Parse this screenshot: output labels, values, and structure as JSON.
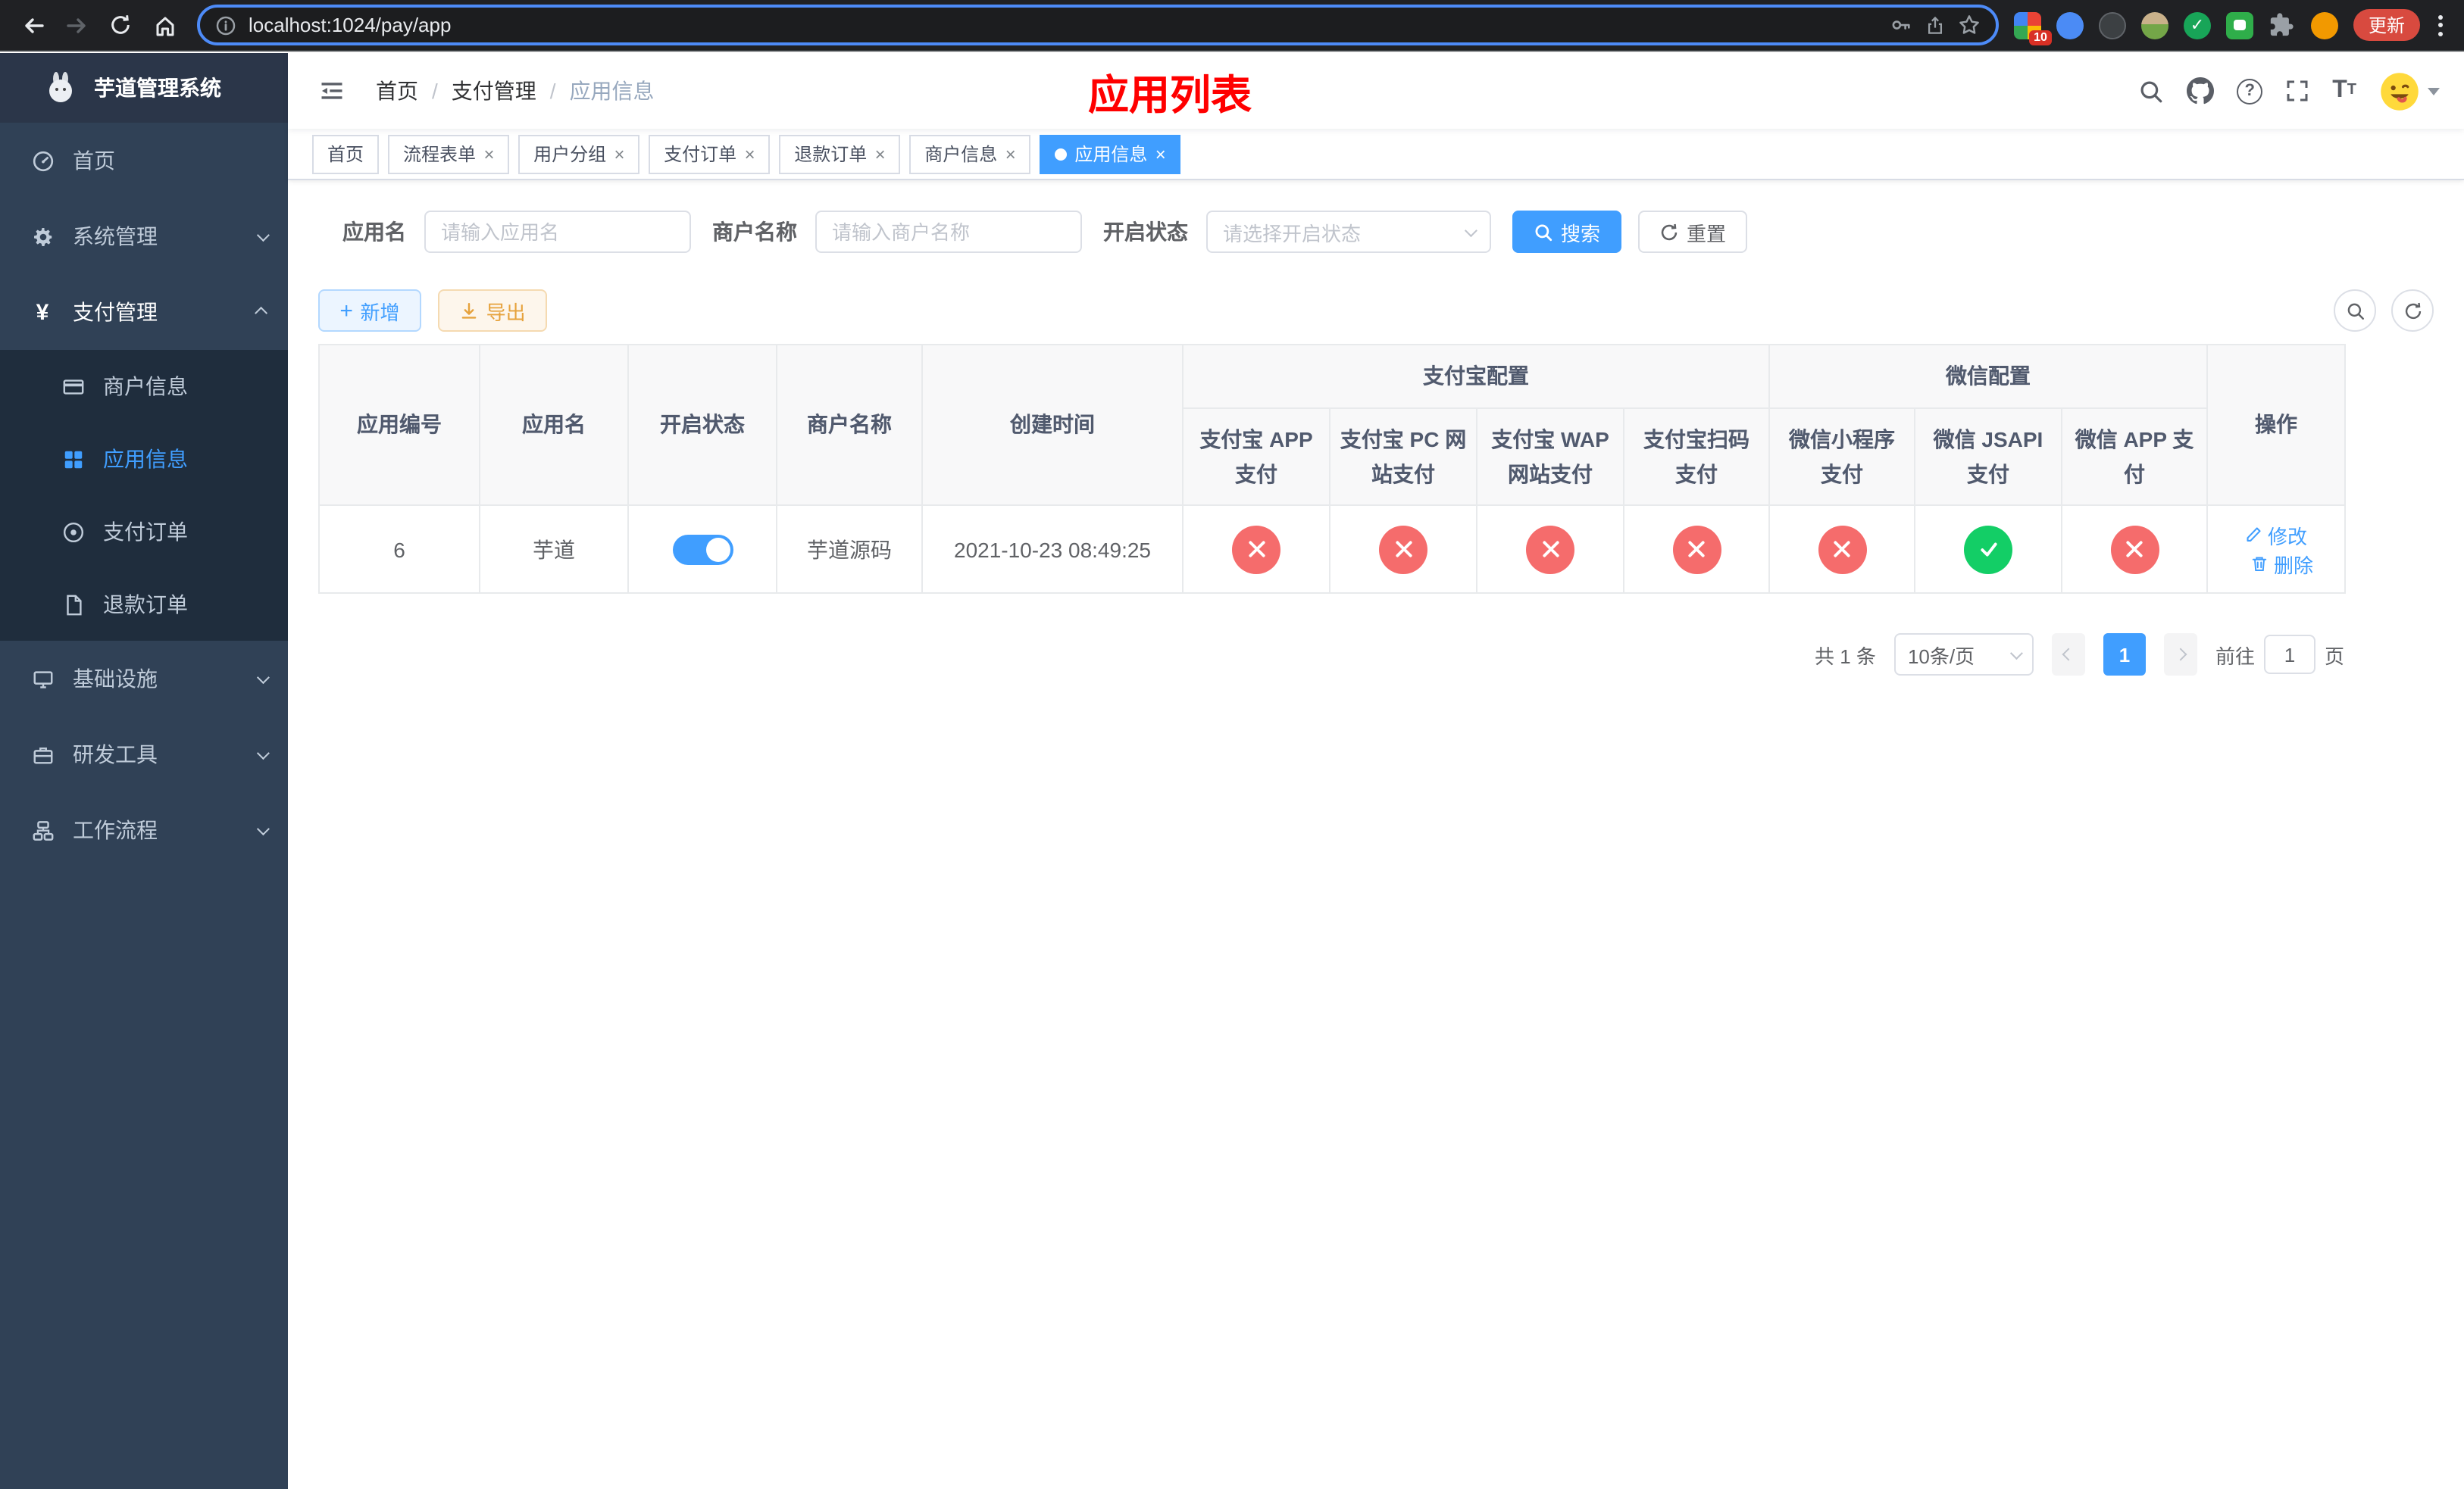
{
  "browser": {
    "url": "localhost:1024/pay/app",
    "update_label": "更新",
    "extension_badge": "10"
  },
  "sidebar": {
    "title": "芋道管理系统",
    "items": {
      "home": "首页",
      "system": "系统管理",
      "payment": "支付管理",
      "merchant_info": "商户信息",
      "app_info": "应用信息",
      "pay_order": "支付订单",
      "refund_order": "退款订单",
      "infrastructure": "基础设施",
      "devtools": "研发工具",
      "workflow": "工作流程"
    }
  },
  "navbar": {
    "breadcrumb": [
      "首页",
      "支付管理",
      "应用信息"
    ],
    "page_title": "应用列表"
  },
  "tabs": [
    {
      "label": "首页"
    },
    {
      "label": "流程表单"
    },
    {
      "label": "用户分组"
    },
    {
      "label": "支付订单"
    },
    {
      "label": "退款订单"
    },
    {
      "label": "商户信息"
    },
    {
      "label": "应用信息"
    }
  ],
  "filters": {
    "app_name_label": "应用名",
    "app_name_placeholder": "请输入应用名",
    "merchant_label": "商户名称",
    "merchant_placeholder": "请输入商户名称",
    "status_label": "开启状态",
    "status_placeholder": "请选择开启状态",
    "search_label": "搜索",
    "reset_label": "重置"
  },
  "toolbar": {
    "add_label": "新增",
    "export_label": "导出"
  },
  "table": {
    "columns": {
      "id": "应用编号",
      "name": "应用名",
      "status": "开启状态",
      "merchant": "商户名称",
      "created": "创建时间",
      "actions": "操作"
    },
    "groups": {
      "alipay": "支付宝配置",
      "wechat": "微信配置"
    },
    "alipay_columns": [
      "支付宝 APP 支付",
      "支付宝 PC 网站支付",
      "支付宝 WAP 网站支付",
      "支付宝扫码支付"
    ],
    "wechat_columns": [
      "微信小程序支付",
      "微信 JSAPI 支付",
      "微信 APP 支付"
    ],
    "rows": [
      {
        "id": "6",
        "name": "芋道",
        "enabled": true,
        "merchant": "芋道源码",
        "created": "2021-10-23 08:49:25",
        "alipay_app": false,
        "alipay_pc": false,
        "alipay_wap": false,
        "alipay_qr": false,
        "wx_lite": false,
        "wx_jsapi": true,
        "wx_app": false
      }
    ],
    "edit_label": "修改",
    "delete_label": "删除"
  },
  "pagination": {
    "total": "共 1 条",
    "page_size": "10条/页",
    "current_page": "1",
    "goto_prefix": "前往",
    "goto_suffix": "页",
    "goto_value": "1"
  },
  "colors": {
    "accent": "#409eff",
    "danger": "#f56c6c",
    "success": "#13ce66",
    "title": "#ff0000"
  }
}
